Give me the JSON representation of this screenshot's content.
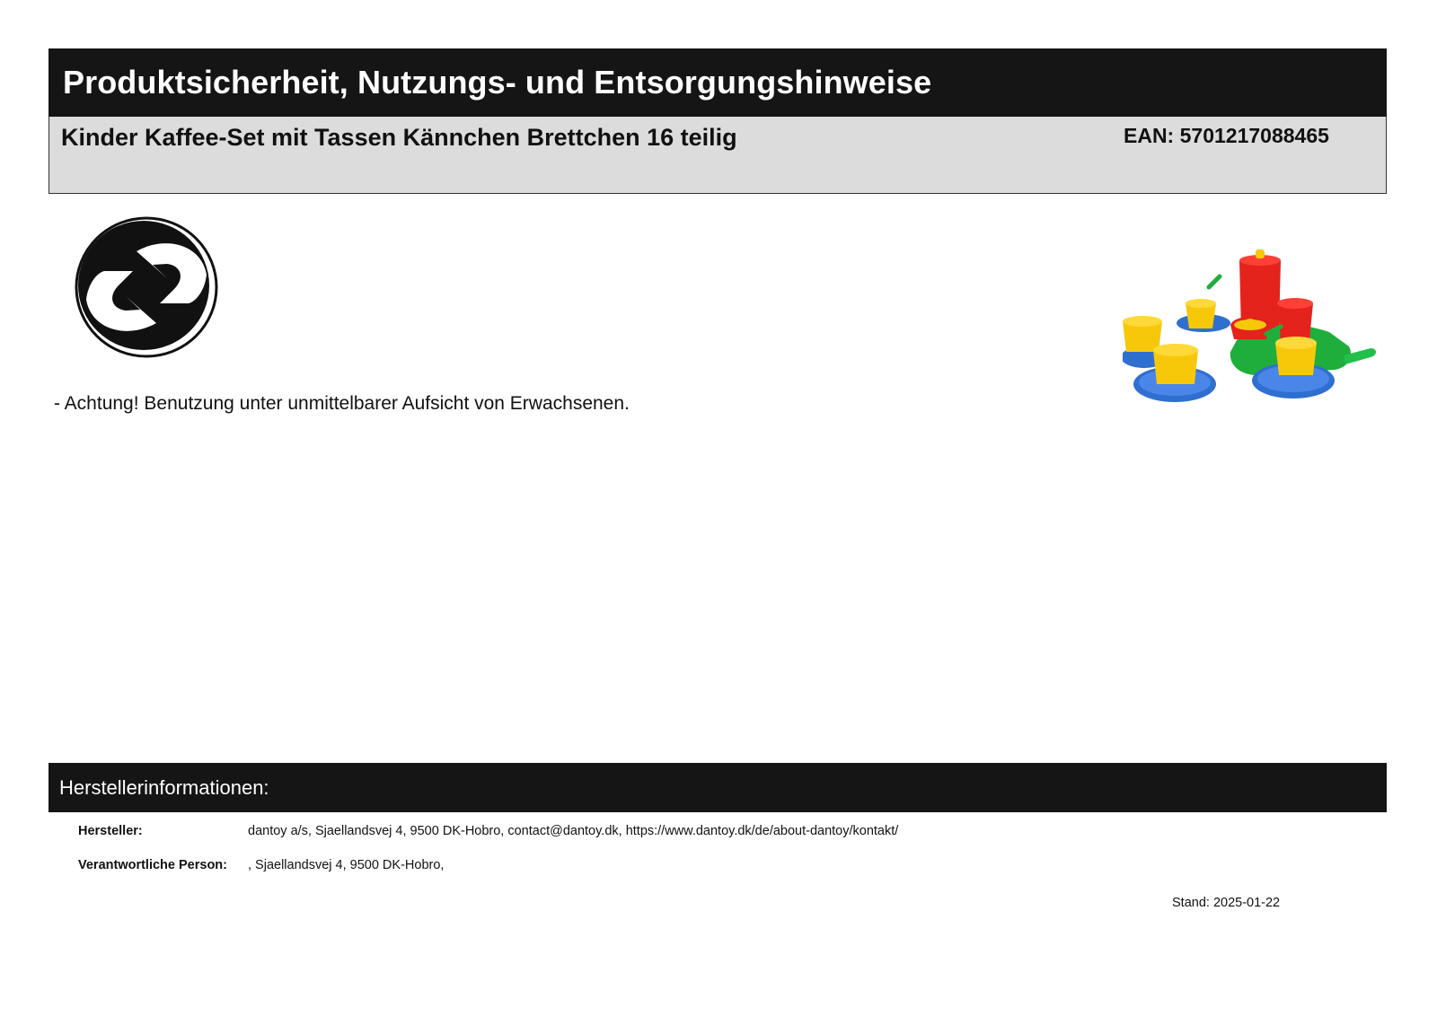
{
  "header": {
    "title": "Produktsicherheit, Nutzungs- und Entsorgungshinweise"
  },
  "product": {
    "name": "Kinder Kaffee-Set mit Tassen Kännchen Brettchen 16 teilig",
    "ean": "EAN: 5701217088465"
  },
  "icons": {
    "recycling": "green-dot-recycling-icon",
    "product": "toy-coffee-set-image"
  },
  "colors": {
    "bar_dark": "#151515",
    "bar_light": "#dcdcdc",
    "toy_red": "#e3231c",
    "toy_yellow": "#f7c80a",
    "toy_blue": "#2f6fd0",
    "toy_green": "#1fae3c"
  },
  "warnings": [
    "- Achtung! Benutzung unter unmittelbarer Aufsicht von Erwachsenen."
  ],
  "manufacturer": {
    "section_title": "Herstellerinformationen:",
    "rows": [
      {
        "label": "Hersteller:",
        "value": "dantoy a/s, Sjaellandsvej 4, 9500 DK-Hobro, contact@dantoy.dk, https://www.dantoy.dk/de/about-dantoy/kontakt/"
      },
      {
        "label": "Verantwortliche Person:",
        "value": ", Sjaellandsvej 4, 9500 DK-Hobro,"
      }
    ]
  },
  "footer": {
    "stand": "Stand: 2025-01-22"
  }
}
